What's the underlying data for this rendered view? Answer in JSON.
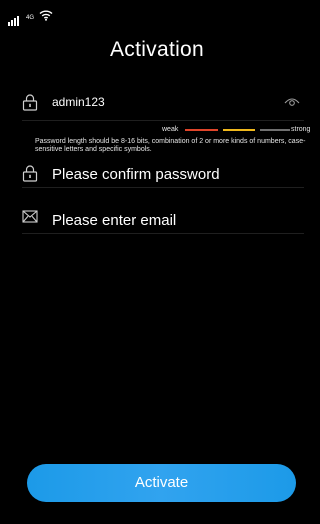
{
  "status_bar": {
    "network_type": "4G",
    "icons": [
      "signal-icon",
      "wifi-icon"
    ]
  },
  "title": "Activation",
  "password": {
    "value": "admin123",
    "icons": [
      "lock-icon",
      "eye-icon"
    ]
  },
  "strength": {
    "weak_label": "weak",
    "strong_label": "strong",
    "colors": {
      "weak": "#e0452a",
      "medium": "#f0b81c",
      "strong": "#707070"
    }
  },
  "hint": "Password length should be 8-16 bits, combination of 2 or more kinds of numbers, case-sensitive letters and specific symbols.",
  "confirm_password": {
    "placeholder": "Please confirm password",
    "icon": "lock-icon"
  },
  "email": {
    "placeholder": "Please enter email",
    "icon": "mail-icon"
  },
  "activate_button": {
    "label": "Activate",
    "color": "#1c9ae8"
  }
}
